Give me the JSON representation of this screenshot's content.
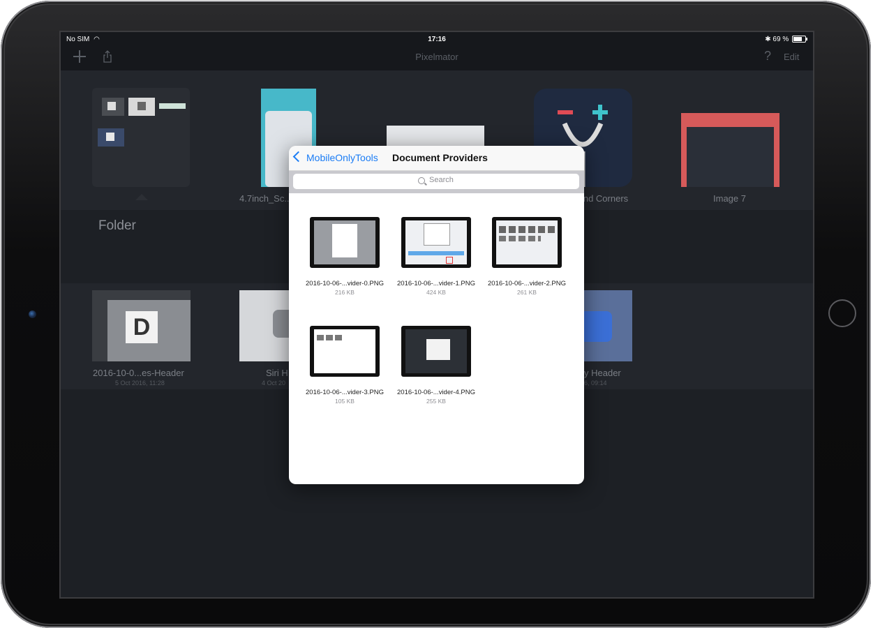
{
  "status_bar": {
    "carrier": "No SIM",
    "time": "17:16",
    "battery_text": "69 %"
  },
  "nav": {
    "title": "Pixelmator",
    "edit_label": "Edit",
    "help_label": "?"
  },
  "background_tiles": {
    "row1": [
      {
        "label": "4.7inch_Sc..."
      },
      {
        "label": "...nd Corners"
      },
      {
        "label": "Image 7"
      }
    ],
    "folder_label": "Folder",
    "row2": [
      {
        "label": "2016-10-0...es-Header",
        "sub": "5 Oct 2016, 11:28"
      },
      {
        "label": "Siri H",
        "sub": "4 Oct 20"
      },
      {
        "label": "y Header",
        "sub": "6, 09:14"
      }
    ]
  },
  "popover": {
    "back_label": "MobileOnlyTools",
    "title": "Document Providers",
    "search_placeholder": "Search",
    "files": [
      {
        "name": "2016-10-06-...vider-0.PNG",
        "size": "216 KB"
      },
      {
        "name": "2016-10-06-...vider-1.PNG",
        "size": "424 KB"
      },
      {
        "name": "2016-10-06-...vider-2.PNG",
        "size": "261 KB"
      },
      {
        "name": "2016-10-06-...vider-3.PNG",
        "size": "105 KB"
      },
      {
        "name": "2016-10-06-...vider-4.PNG",
        "size": "255 KB"
      }
    ]
  },
  "colors": {
    "accent": "#1a7cf5",
    "screen_bg": "#1d2025"
  }
}
